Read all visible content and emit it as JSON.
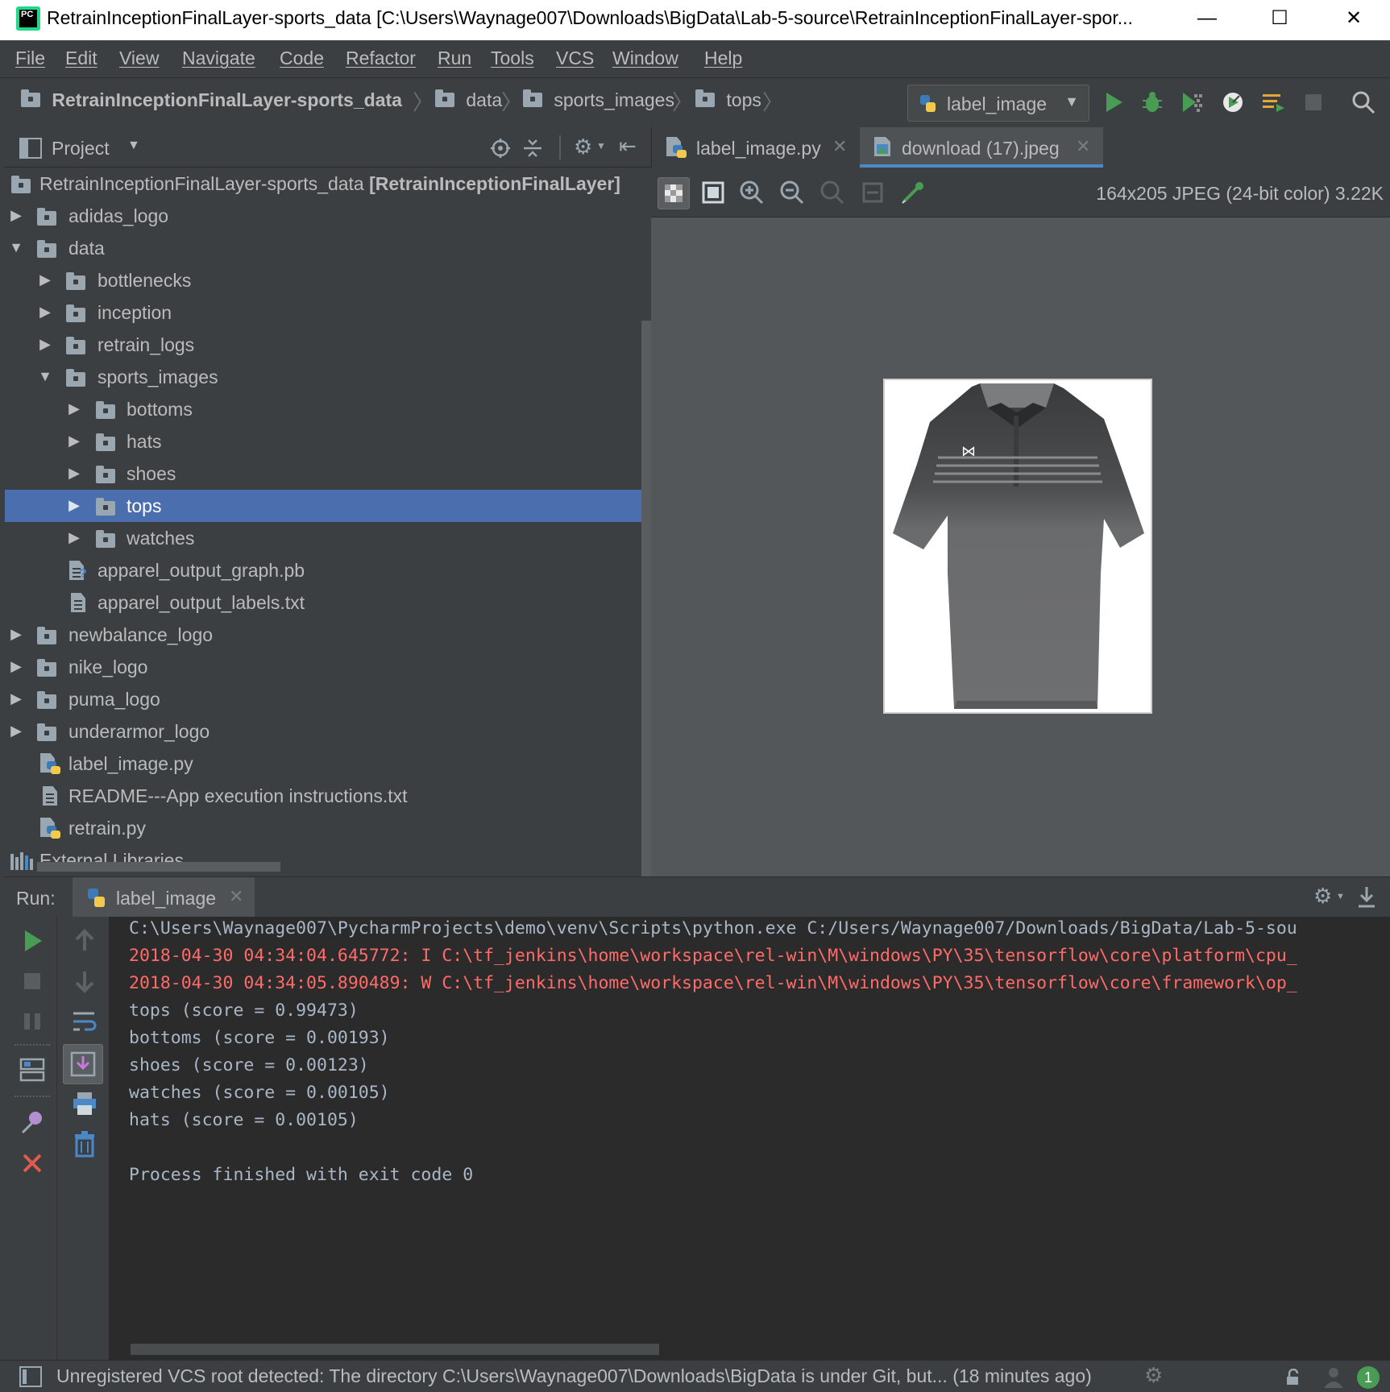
{
  "window": {
    "title": "RetrainInceptionFinalLayer-sports_data [C:\\Users\\Waynage007\\Downloads\\BigData\\Lab-5-source\\RetrainInceptionFinalLayer-spor...",
    "app_icon_text": "PC",
    "minimize": "—",
    "maximize": "☐",
    "close": "✕"
  },
  "menu": [
    "File",
    "Edit",
    "View",
    "Navigate",
    "Code",
    "Refactor",
    "Run",
    "Tools",
    "VCS",
    "Window",
    "Help"
  ],
  "breadcrumb": [
    "RetrainInceptionFinalLayer-sports_data",
    "data",
    "sports_images",
    "tops"
  ],
  "run_config": "label_image",
  "project_panel": {
    "title": "Project",
    "tree": [
      {
        "label": "RetrainInceptionFinalLayer-sports_data",
        "suffix": "[RetrainInceptionFinalLayer]",
        "type": "folder",
        "level": 0,
        "expanded": null
      },
      {
        "label": "adidas_logo",
        "type": "folder",
        "level": 0,
        "expanded": false
      },
      {
        "label": "data",
        "type": "folder",
        "level": 0,
        "expanded": true
      },
      {
        "label": "bottlenecks",
        "type": "folder",
        "level": 1,
        "expanded": false
      },
      {
        "label": "inception",
        "type": "folder",
        "level": 1,
        "expanded": false
      },
      {
        "label": "retrain_logs",
        "type": "folder",
        "level": 1,
        "expanded": false
      },
      {
        "label": "sports_images",
        "type": "folder",
        "level": 1,
        "expanded": true
      },
      {
        "label": "bottoms",
        "type": "folder",
        "level": 2,
        "expanded": false
      },
      {
        "label": "hats",
        "type": "folder",
        "level": 2,
        "expanded": false
      },
      {
        "label": "shoes",
        "type": "folder",
        "level": 2,
        "expanded": false
      },
      {
        "label": "tops",
        "type": "folder",
        "level": 2,
        "expanded": false,
        "selected": true
      },
      {
        "label": "watches",
        "type": "folder",
        "level": 2,
        "expanded": false
      },
      {
        "label": "apparel_output_graph.pb",
        "type": "unknown",
        "level": 1,
        "expanded": null
      },
      {
        "label": "apparel_output_labels.txt",
        "type": "text",
        "level": 1,
        "expanded": null
      },
      {
        "label": "newbalance_logo",
        "type": "folder",
        "level": 0,
        "expanded": false
      },
      {
        "label": "nike_logo",
        "type": "folder",
        "level": 0,
        "expanded": false
      },
      {
        "label": "puma_logo",
        "type": "folder",
        "level": 0,
        "expanded": false
      },
      {
        "label": "underarmor_logo",
        "type": "folder",
        "level": 0,
        "expanded": false
      },
      {
        "label": "label_image.py",
        "type": "python",
        "level": 0,
        "expanded": null
      },
      {
        "label": "README---App execution instructions.txt",
        "type": "text",
        "level": 0,
        "expanded": null
      },
      {
        "label": "retrain.py",
        "type": "python",
        "level": 0,
        "expanded": null
      },
      {
        "label": "External Libraries",
        "type": "library",
        "level": -1,
        "expanded": null
      }
    ]
  },
  "editor_tabs": [
    {
      "label": "label_image.py",
      "active": false
    },
    {
      "label": "download (17).jpeg",
      "active": true
    }
  ],
  "image_info": "164x205 JPEG (24-bit color) 3.22K",
  "run_panel": {
    "label": "Run:",
    "tab": "label_image",
    "console": [
      {
        "text": "C:\\Users\\Waynage007\\PycharmProjects\\demo\\venv\\Scripts\\python.exe C:/Users/Waynage007/Downloads/BigData/Lab-5-sou",
        "kind": "normal"
      },
      {
        "text": "2018-04-30 04:34:04.645772: I C:\\tf_jenkins\\home\\workspace\\rel-win\\M\\windows\\PY\\35\\tensorflow\\core\\platform\\cpu_",
        "kind": "err"
      },
      {
        "text": "2018-04-30 04:34:05.890489: W C:\\tf_jenkins\\home\\workspace\\rel-win\\M\\windows\\PY\\35\\tensorflow\\core\\framework\\op_",
        "kind": "err"
      },
      {
        "text": "tops (score = 0.99473)",
        "kind": "normal"
      },
      {
        "text": "bottoms (score = 0.00193)",
        "kind": "normal"
      },
      {
        "text": "shoes (score = 0.00123)",
        "kind": "normal"
      },
      {
        "text": "watches (score = 0.00105)",
        "kind": "normal"
      },
      {
        "text": "hats (score = 0.00105)",
        "kind": "normal"
      },
      {
        "text": "",
        "kind": "normal"
      },
      {
        "text": "Process finished with exit code 0",
        "kind": "normal"
      }
    ]
  },
  "status_bar": {
    "message": "Unregistered VCS root detected: The directory C:\\Users\\Waynage007\\Downloads\\BigData is under Git, but... (18 minutes ago)",
    "notification_count": "1"
  },
  "colors": {
    "selection": "#4b6eaf",
    "run_green": "#499c54",
    "error_red": "#ff6b68"
  }
}
